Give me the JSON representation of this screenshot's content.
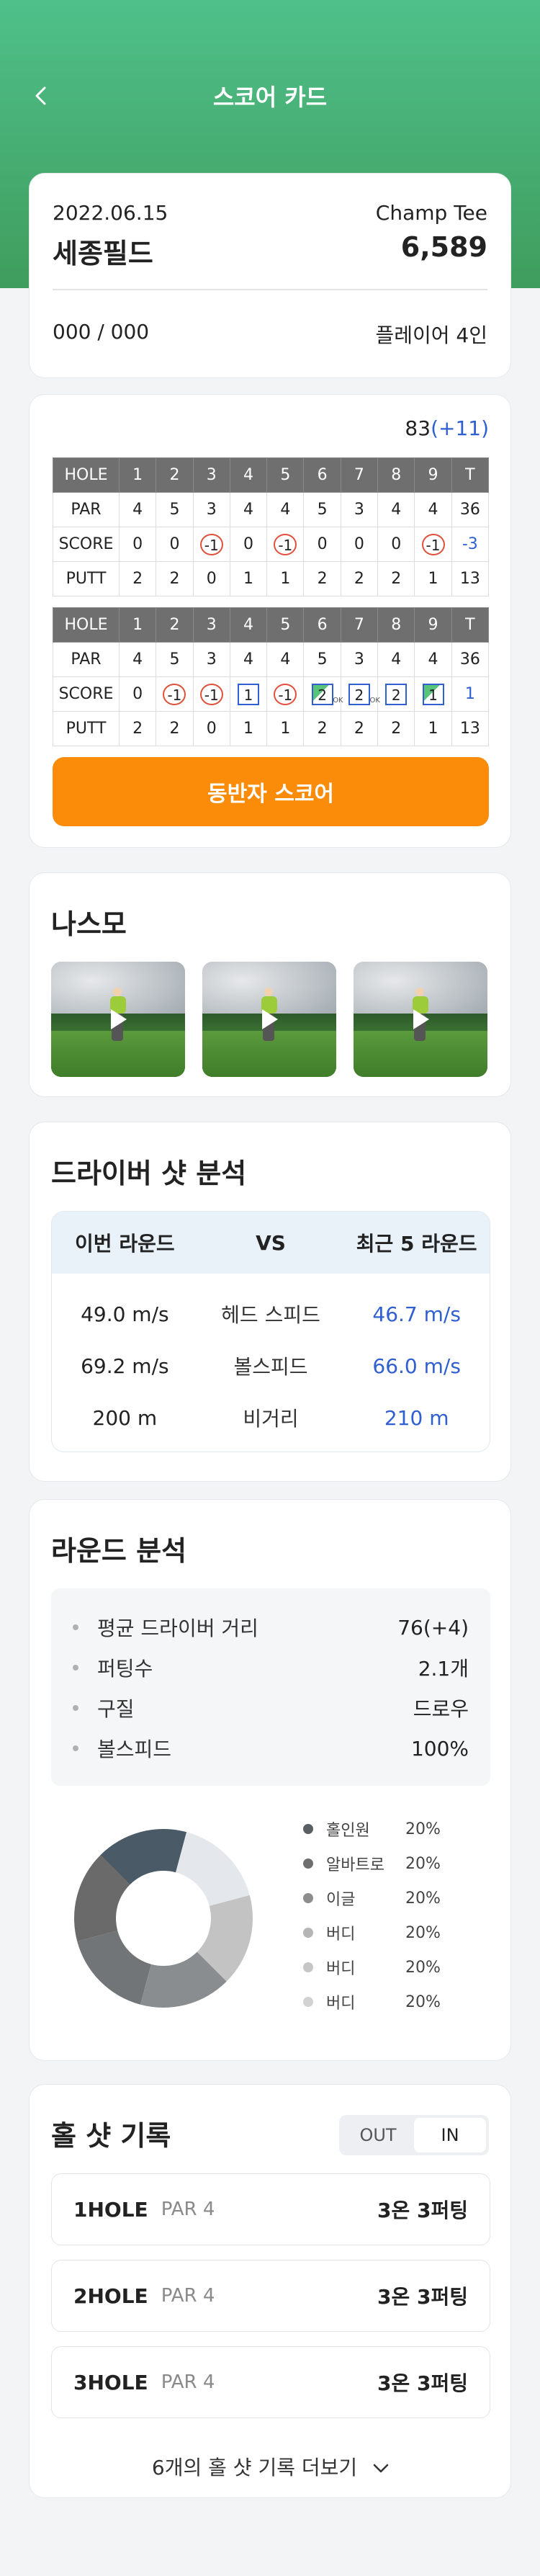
{
  "header": {
    "title": "스코어 카드"
  },
  "summary": {
    "date": "2022.06.15",
    "tee": "Champ Tee",
    "course": "세종필드",
    "yardage": "6,589",
    "handicap": "000 / 000",
    "players": "플레이어 4인"
  },
  "scorecard": {
    "total": "83",
    "total_diff": "(+11)",
    "holes": [
      "1",
      "2",
      "3",
      "4",
      "5",
      "6",
      "7",
      "8",
      "9",
      "T"
    ],
    "table1": {
      "hole_label": "HOLE",
      "par_label": "PAR",
      "score_label": "SCORE",
      "putt_label": "PUTT",
      "par": [
        "4",
        "5",
        "3",
        "4",
        "4",
        "5",
        "3",
        "4",
        "4",
        "36"
      ],
      "score": [
        "0",
        "0",
        "-1",
        "0",
        "-1",
        "0",
        "0",
        "0",
        "-1",
        "-3"
      ],
      "putt": [
        "2",
        "2",
        "0",
        "1",
        "1",
        "2",
        "2",
        "2",
        "1",
        "13"
      ]
    },
    "table2": {
      "hole_label": "HOLE",
      "par_label": "PAR",
      "score_label": "SCORE",
      "putt_label": "PUTT",
      "par": [
        "4",
        "5",
        "3",
        "4",
        "4",
        "5",
        "3",
        "4",
        "4",
        "36"
      ],
      "score": [
        "0",
        "-1",
        "-1",
        "1",
        "-1",
        "2",
        "2",
        "2",
        "1",
        "1"
      ],
      "ok_marks": [
        "OK",
        "OK"
      ],
      "putt": [
        "2",
        "2",
        "0",
        "1",
        "1",
        "2",
        "2",
        "2",
        "1",
        "13"
      ]
    },
    "companion_button": "동반자 스코어"
  },
  "nasmo": {
    "title": "나스모"
  },
  "driver": {
    "title": "드라이버 샷 분석",
    "col_mine": "이번 라운드",
    "col_vs": "VS",
    "col_recent": "최근 5 라운드",
    "rows": [
      {
        "mine": "49.0 m/s",
        "label": "헤드 스피드",
        "recent": "46.7 m/s"
      },
      {
        "mine": "69.2 m/s",
        "label": "볼스피드",
        "recent": "66.0 m/s"
      },
      {
        "mine": "200 m",
        "label": "비거리",
        "recent": "210 m"
      }
    ]
  },
  "round": {
    "title": "라운드 분석",
    "stats": [
      {
        "label": "평균 드라이버 거리",
        "value": "76(+4)"
      },
      {
        "label": "퍼팅수",
        "value": "2.1개"
      },
      {
        "label": "구질",
        "value": "드로우"
      },
      {
        "label": "볼스피드",
        "value": "100%"
      }
    ],
    "legend": [
      {
        "name": "홀인원",
        "pct": "20%",
        "color": "#5a5f63"
      },
      {
        "name": "알바트로",
        "pct": "20%",
        "color": "#6e6e6e"
      },
      {
        "name": "이글",
        "pct": "20%",
        "color": "#8d8d8d"
      },
      {
        "name": "버디",
        "pct": "20%",
        "color": "#b5b5b5"
      },
      {
        "name": "버디",
        "pct": "20%",
        "color": "#c6c6c6"
      },
      {
        "name": "버디",
        "pct": "20%",
        "color": "#d2d2d2"
      }
    ]
  },
  "chart_data": {
    "type": "pie",
    "categories": [
      "홀인원",
      "알바트로",
      "이글",
      "버디",
      "버디",
      "버디"
    ],
    "values": [
      20,
      20,
      20,
      20,
      20,
      20
    ],
    "segment_colors": [
      "#4a5a66",
      "#e4e8ec",
      "#c3c3c3",
      "#8a8d90",
      "#727577",
      "#6a6a6a"
    ]
  },
  "holes": {
    "title": "홀 샷 기록",
    "toggle_out": "OUT",
    "toggle_in": "IN",
    "rows": [
      {
        "hole": "1HOLE",
        "par": "PAR 4",
        "result": "3온 3퍼팅"
      },
      {
        "hole": "2HOLE",
        "par": "PAR 4",
        "result": "3온 3퍼팅"
      },
      {
        "hole": "3HOLE",
        "par": "PAR 4",
        "result": "3온 3퍼팅"
      }
    ],
    "more_label": "6개의 홀 샷 기록 더보기"
  }
}
